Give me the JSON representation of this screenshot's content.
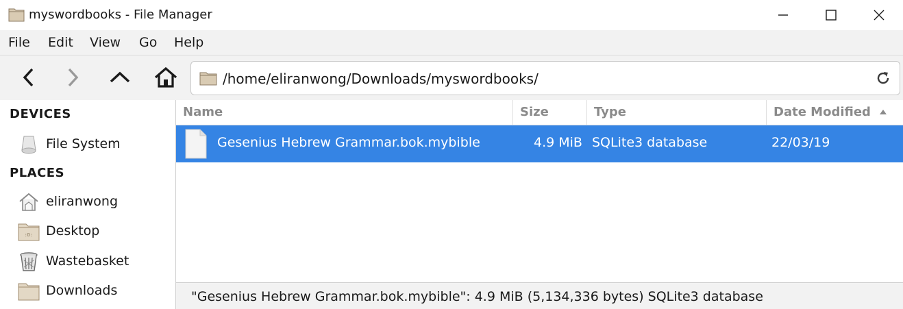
{
  "window": {
    "title": "myswordbooks - File Manager",
    "icons": {
      "app": "folder-icon",
      "minimize": "minimize-icon",
      "maximize": "maximize-icon",
      "close": "close-icon"
    }
  },
  "menu": [
    "File",
    "Edit",
    "View",
    "Go",
    "Help"
  ],
  "toolbar": {
    "icons": [
      "back-arrow-icon",
      "forward-arrow-icon",
      "up-arrow-icon",
      "home-icon"
    ],
    "address": "/home/eliranwong/Downloads/myswordbooks/",
    "reload_icon": "reload-icon"
  },
  "sidebar": {
    "devices_header": "DEVICES",
    "devices": [
      {
        "label": "File System",
        "icon": "drive-icon"
      }
    ],
    "places_header": "PLACES",
    "places": [
      {
        "label": "eliranwong",
        "icon": "home-icon"
      },
      {
        "label": "Desktop",
        "icon": "desktop-folder-icon"
      },
      {
        "label": "Wastebasket",
        "icon": "trash-icon"
      },
      {
        "label": "Downloads",
        "icon": "folder-icon"
      }
    ]
  },
  "columns": [
    "Name",
    "Size",
    "Type",
    "Date Modified"
  ],
  "sort": {
    "column": "Date Modified",
    "direction": "ascending"
  },
  "files": [
    {
      "name": "Gesenius Hebrew Grammar.bok.mybible",
      "size": "4.9 MiB",
      "type": "SQLite3 database",
      "date": "22/03/19",
      "icon": "file-icon",
      "selected": true
    }
  ],
  "status": "\"Gesenius Hebrew Grammar.bok.mybible\": 4.9 MiB (5,134,336 bytes) SQLite3 database",
  "colors": {
    "selection": "#3584e4",
    "bar_background": "#f2f2f2",
    "header_text": "#8a8a8a"
  }
}
